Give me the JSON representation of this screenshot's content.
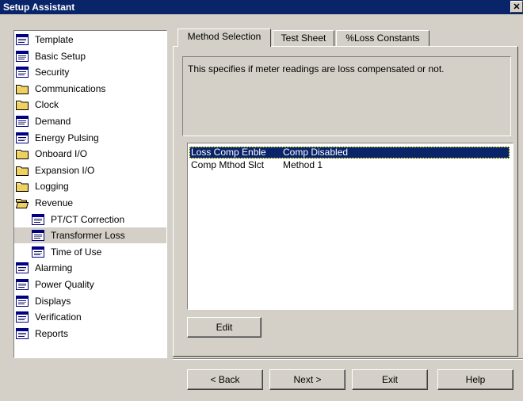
{
  "window": {
    "title": "Setup Assistant",
    "close_glyph": "✕"
  },
  "tree": [
    {
      "label": "Template",
      "icon": "document-icon",
      "indent": 0,
      "selected": false
    },
    {
      "label": "Basic Setup",
      "icon": "document-icon",
      "indent": 0,
      "selected": false
    },
    {
      "label": "Security",
      "icon": "document-icon",
      "indent": 0,
      "selected": false
    },
    {
      "label": "Communications",
      "icon": "folder-icon",
      "indent": 0,
      "selected": false
    },
    {
      "label": "Clock",
      "icon": "folder-icon",
      "indent": 0,
      "selected": false
    },
    {
      "label": "Demand",
      "icon": "document-icon",
      "indent": 0,
      "selected": false
    },
    {
      "label": "Energy Pulsing",
      "icon": "document-icon",
      "indent": 0,
      "selected": false
    },
    {
      "label": "Onboard I/O",
      "icon": "folder-icon",
      "indent": 0,
      "selected": false
    },
    {
      "label": "Expansion I/O",
      "icon": "folder-icon",
      "indent": 0,
      "selected": false
    },
    {
      "label": "Logging",
      "icon": "folder-icon",
      "indent": 0,
      "selected": false
    },
    {
      "label": "Revenue",
      "icon": "folder-open-icon",
      "indent": 0,
      "selected": false
    },
    {
      "label": "PT/CT Correction",
      "icon": "document-icon",
      "indent": 1,
      "selected": false
    },
    {
      "label": "Transformer Loss",
      "icon": "document-icon",
      "indent": 1,
      "selected": true
    },
    {
      "label": "Time of Use",
      "icon": "document-icon",
      "indent": 1,
      "selected": false
    },
    {
      "label": "Alarming",
      "icon": "document-icon",
      "indent": 0,
      "selected": false
    },
    {
      "label": "Power Quality",
      "icon": "document-icon",
      "indent": 0,
      "selected": false
    },
    {
      "label": "Displays",
      "icon": "document-icon",
      "indent": 0,
      "selected": false
    },
    {
      "label": "Verification",
      "icon": "document-icon",
      "indent": 0,
      "selected": false
    },
    {
      "label": "Reports",
      "icon": "document-icon",
      "indent": 0,
      "selected": false
    }
  ],
  "tabs": [
    {
      "label": "Method Selection",
      "active": true
    },
    {
      "label": "Test Sheet",
      "active": false
    },
    {
      "label": "%Loss Constants",
      "active": false
    }
  ],
  "description": "This specifies if meter readings are loss compensated or not.",
  "settings": [
    {
      "name": "Loss Comp Enble",
      "value": "Comp Disabled",
      "selected": true
    },
    {
      "name": "Comp Mthod Slct",
      "value": "Method 1",
      "selected": false
    }
  ],
  "buttons": {
    "edit": "Edit",
    "back": "< Back",
    "next": "Next >",
    "exit": "Exit",
    "help": "Help"
  },
  "colors": {
    "titlebar": "#0a246a",
    "selection": "#0a246a",
    "face": "#d4d0c8"
  }
}
